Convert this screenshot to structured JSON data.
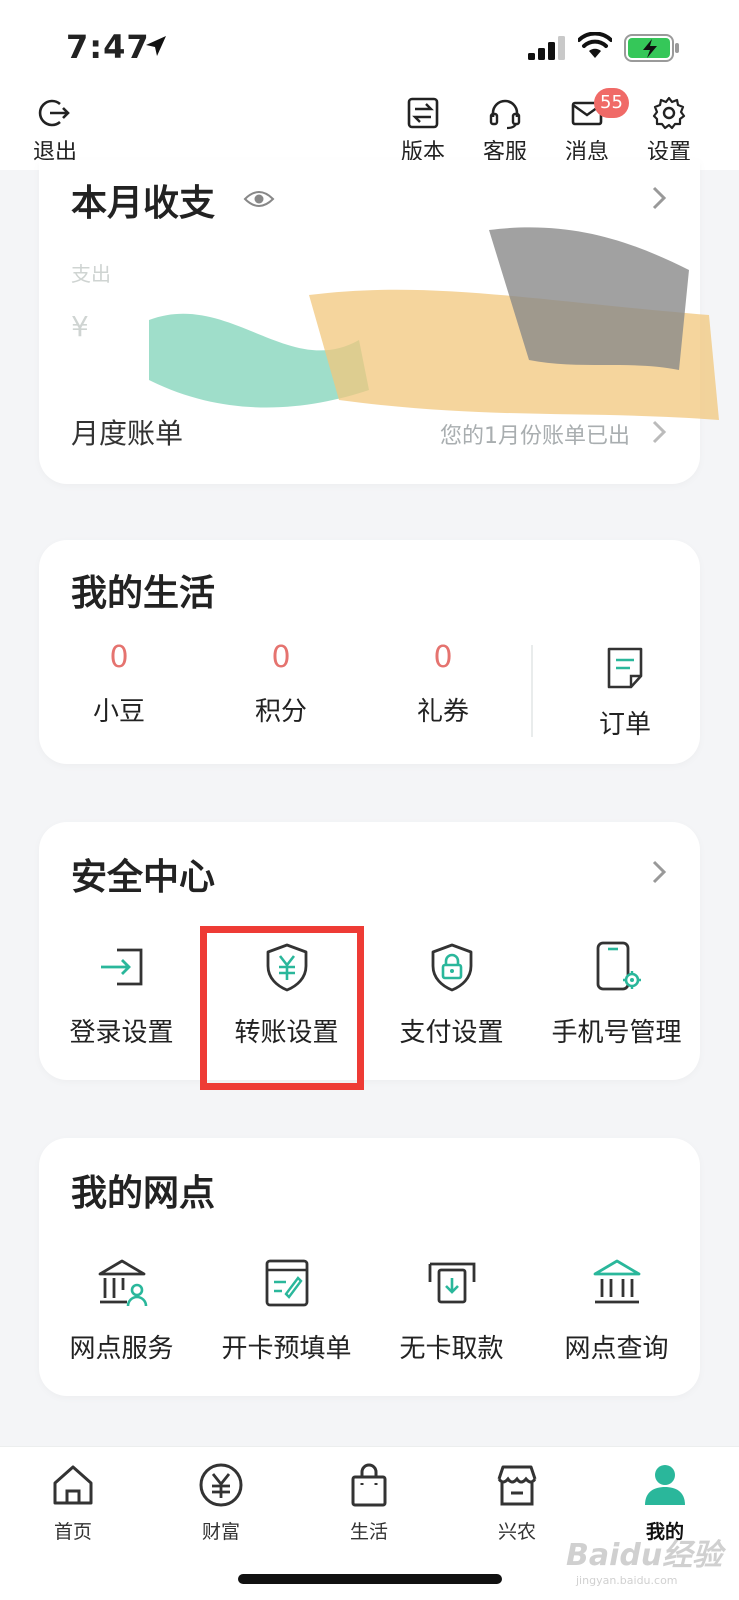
{
  "status_bar": {
    "time": "7:47"
  },
  "top_actions": {
    "logout": "退出",
    "version": "版本",
    "service": "客服",
    "messages": "消息",
    "messages_badge": "55",
    "settings": "设置"
  },
  "monthly": {
    "title": "本月收支",
    "expense_label": "支出",
    "amount_prefix": "¥",
    "bill_label": "月度账单",
    "bill_note": "您的1月份账单已出"
  },
  "life": {
    "title": "我的生活",
    "stats": [
      {
        "value": "0",
        "label": "小豆"
      },
      {
        "value": "0",
        "label": "积分"
      },
      {
        "value": "0",
        "label": "礼券"
      }
    ],
    "order_label": "订单"
  },
  "security": {
    "title": "安全中心",
    "items": [
      {
        "label": "登录设置",
        "icon": "login-icon"
      },
      {
        "label": "转账设置",
        "icon": "transfer-shield-icon"
      },
      {
        "label": "支付设置",
        "icon": "payment-lock-icon"
      },
      {
        "label": "手机号管理",
        "icon": "phone-settings-icon"
      }
    ]
  },
  "outlets": {
    "title": "我的网点",
    "items": [
      {
        "label": "网点服务",
        "icon": "bank-person-icon"
      },
      {
        "label": "开卡预填单",
        "icon": "form-edit-icon"
      },
      {
        "label": "无卡取款",
        "icon": "atm-withdraw-icon"
      },
      {
        "label": "网点查询",
        "icon": "bank-building-icon"
      }
    ]
  },
  "bottom_nav": {
    "items": [
      {
        "label": "首页",
        "icon": "home-icon"
      },
      {
        "label": "财富",
        "icon": "wealth-icon"
      },
      {
        "label": "生活",
        "icon": "bag-icon"
      },
      {
        "label": "兴农",
        "icon": "shop-icon"
      },
      {
        "label": "我的",
        "icon": "user-icon",
        "active": true
      }
    ]
  },
  "watermark": {
    "text": "Baidu经验",
    "sub": "jingyan.baidu.com"
  },
  "colors": {
    "accent": "#2ab79b",
    "badge": "#f06a67",
    "stat_number": "#e5736f",
    "highlight": "#ee3b35"
  }
}
